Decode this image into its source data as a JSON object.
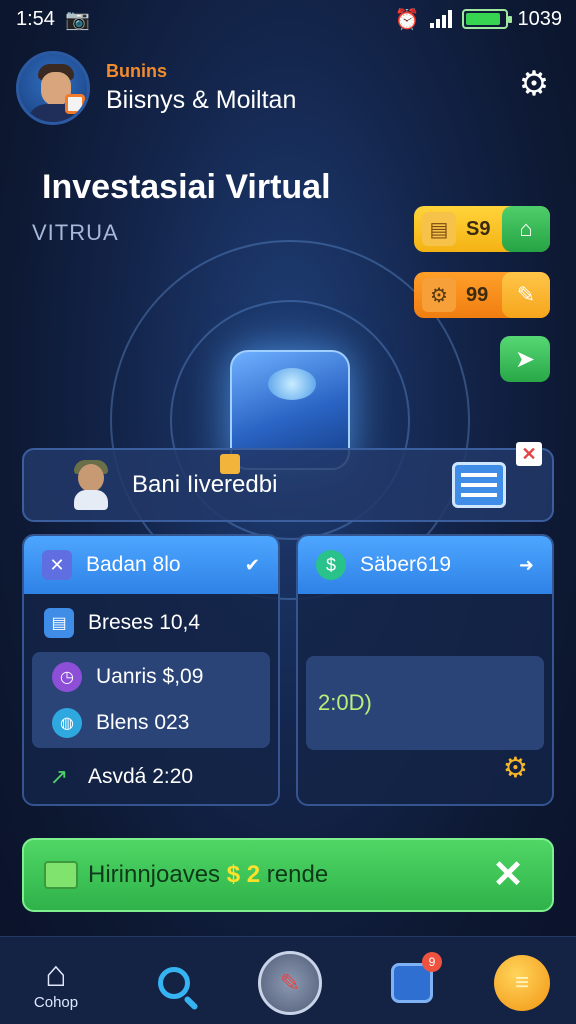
{
  "status_bar": {
    "time": "1:54",
    "battery_text": "1039",
    "battery_level": 0.9
  },
  "header": {
    "brand": "Bunins",
    "user_name": "Biisnys & Moiltan",
    "icons": [
      "avatar",
      "gear-icon"
    ]
  },
  "page": {
    "title": "Investasiai Virtual",
    "subtitle": "VITRUA"
  },
  "side_chips": {
    "yellow_value": "S9",
    "orange_value": "99"
  },
  "banner": {
    "label": "Bani Iiveredbi"
  },
  "left_panel": {
    "header": "Badan 8lo",
    "rows": [
      "Breses 10,4",
      "Uanris $,09",
      "Blens 023",
      "Asvdá 2:20"
    ]
  },
  "right_panel": {
    "header": "Säber619",
    "value": "2:0D)"
  },
  "promo": {
    "prefix": "Hirinnjoaves",
    "amount": "$ 2",
    "suffix": "rende"
  },
  "bottom_nav": {
    "home_label": "Cohop",
    "badge_count": "9",
    "items": [
      "home-icon",
      "search-icon",
      "center-action-icon",
      "box-icon",
      "coins-icon"
    ]
  },
  "colors": {
    "accent_blue": "#2f82e6",
    "accent_green": "#2fb24a",
    "accent_orange": "#f28b2c",
    "accent_yellow": "#f4b214"
  }
}
